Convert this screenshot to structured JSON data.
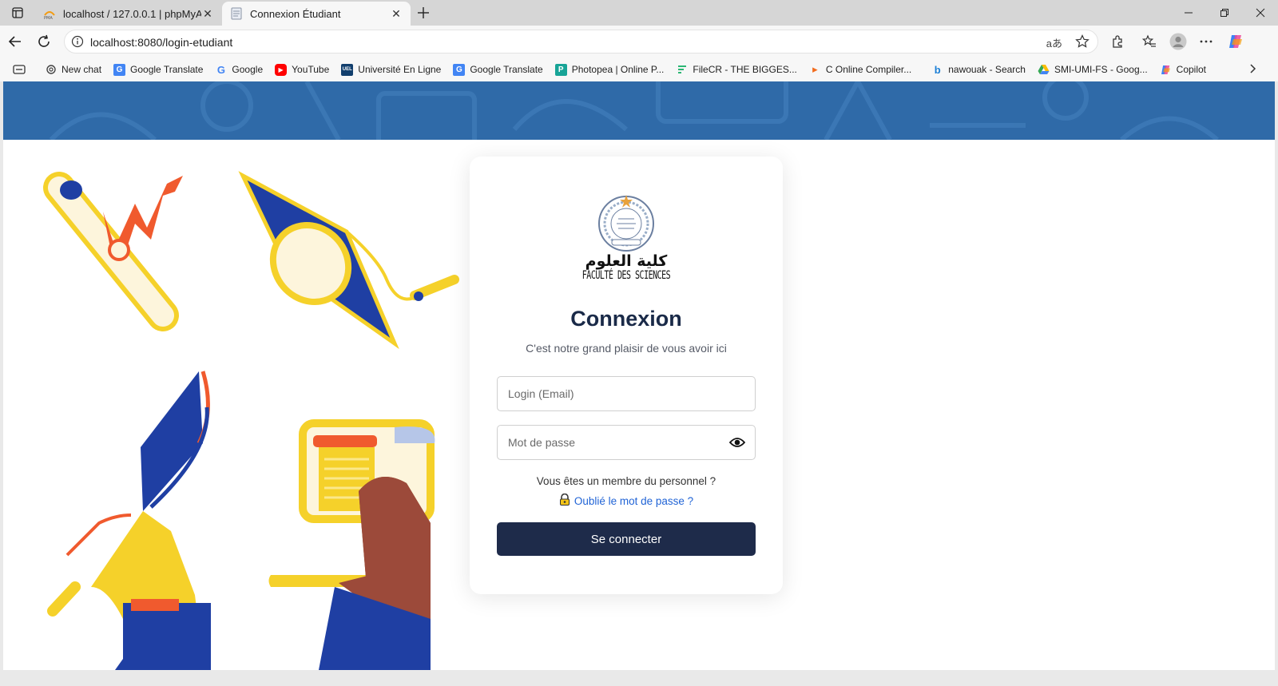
{
  "browser": {
    "tabs": [
      {
        "title": "localhost / 127.0.0.1 | phpMyAdmin",
        "active": false,
        "favicon": "phpmyadmin-icon"
      },
      {
        "title": "Connexion Étudiant",
        "active": true,
        "favicon": "page-icon"
      }
    ],
    "url": "localhost:8080/login-etudiant",
    "read_aloud_glyph": "aあ",
    "bookmarks": [
      {
        "label": "New chat",
        "icon": "openai-icon"
      },
      {
        "label": "Google Translate",
        "icon": "translate-icon"
      },
      {
        "label": "Google",
        "icon": "google-icon"
      },
      {
        "label": "YouTube",
        "icon": "youtube-icon"
      },
      {
        "label": "Université En Ligne",
        "icon": "uel-icon"
      },
      {
        "label": "Google Translate",
        "icon": "translate-icon"
      },
      {
        "label": "Photopea | Online P...",
        "icon": "photopea-icon"
      },
      {
        "label": "FileCR - THE BIGGES...",
        "icon": "filecr-icon"
      },
      {
        "label": "C Online Compiler...",
        "icon": "compiler-icon"
      },
      {
        "label": "nawouak - Search",
        "icon": "bing-icon"
      },
      {
        "label": "SMI-UMI-FS - Goog...",
        "icon": "drive-icon"
      },
      {
        "label": "Copilot",
        "icon": "copilot-icon"
      }
    ],
    "uel_badge": "UEL"
  },
  "login": {
    "logo_arabic": "كلية العلوم",
    "logo_french": "FACULTÉ DES SCIENCES",
    "title": "Connexion",
    "subtitle": "C'est notre grand plaisir de vous avoir ici",
    "email_placeholder": "Login (Email)",
    "password_placeholder": "Mot de passe",
    "staff_text": "Vous êtes un membre du personnel ?",
    "forgot_text": "Oublié le mot de passe ?",
    "submit_label": "Se connecter"
  },
  "colors": {
    "banner": "#2f6aa8",
    "button": "#1e2b4a",
    "title": "#1a2a48",
    "link": "#2164d6"
  }
}
